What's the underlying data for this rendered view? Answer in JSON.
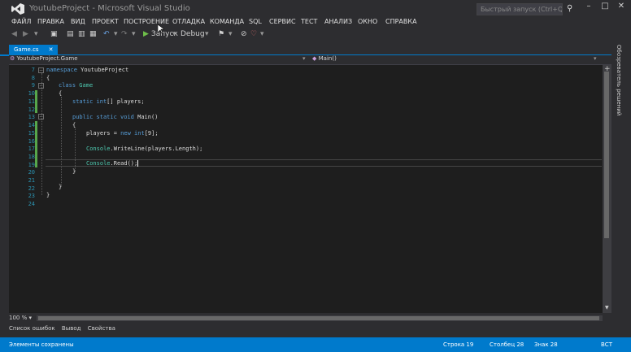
{
  "window": {
    "title": "YoutubeProject - Microsoft Visual Studio",
    "quick_launch_placeholder": "Быстрый запуск (Ctrl+Q)",
    "controls": [
      "–",
      "□",
      "✕"
    ]
  },
  "menu": [
    "ФАЙЛ",
    "ПРАВКА",
    "ВИД",
    "ПРОЕКТ",
    "ПОСТРОЕНИЕ",
    "ОТЛАДКА",
    "КОМАНДА",
    "SQL",
    "СЕРВИС",
    "ТЕСТ",
    "АНАЛИЗ",
    "ОКНО",
    "СПРАВКА"
  ],
  "toolbar": {
    "start_label": "Запуск",
    "config_label": "Debug"
  },
  "tab": {
    "label": "Game.cs",
    "close": "✕"
  },
  "navigation": {
    "class_path": "YoutubeProject.Game",
    "member": "Main()"
  },
  "editor": {
    "line_numbers": [
      "7",
      "8",
      "9",
      "10",
      "11",
      "12",
      "13",
      "14",
      "15",
      "16",
      "17",
      "18",
      "19",
      "20",
      "21",
      "22",
      "23",
      "24"
    ],
    "lines": {
      "l7_kw": "namespace",
      "l7_rest": " YoutubeProject",
      "l8": "{",
      "l9_kw": "class",
      "l9_type": "Game",
      "l10": "{",
      "l11_kw1": "static",
      "l11_kw2": "int",
      "l11_rest": "[] players;",
      "l12": "",
      "l13_kw1": "public",
      "l13_kw2": "static",
      "l13_kw3": "void",
      "l13_rest": " Main()",
      "l14": "{",
      "l15_a": "players = ",
      "l15_kw1": "new",
      "l15_kw2": "int",
      "l15_b": "[9];",
      "l17_type": "Console",
      "l17_rest": ".WriteLine(players.Length);",
      "l19_type": "Console",
      "l19_rest": ".Read();",
      "l20": "}",
      "l22": "}",
      "l23": "}"
    }
  },
  "side_panel": {
    "label": "Обозреватель решений"
  },
  "bottom": {
    "zoom": "100 %",
    "tabs": [
      "Список ошибок",
      "Вывод",
      "Свойства"
    ]
  },
  "status": {
    "message": "Элементы сохранены",
    "row": "Строка 19",
    "col": "Столбец 28",
    "char": "Знак 28",
    "mode": "ВСТ"
  },
  "colors": {
    "accent": "#007acc",
    "keyword": "#569cd6",
    "type": "#4ec9b0",
    "line_number": "#2b91af"
  }
}
